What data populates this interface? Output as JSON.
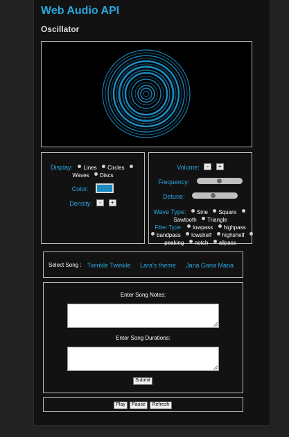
{
  "header": {
    "title": "Web Audio API",
    "subtitle": "Oscillator"
  },
  "display": {
    "label": "Display:",
    "options": [
      "Lines",
      "Circles",
      "Waves",
      "Discs"
    ],
    "color_label": "Color:",
    "color_value": "#1b8bc2",
    "density_label": "Density:",
    "minus": "-",
    "plus": "+"
  },
  "sound": {
    "volume_label": "Volume:",
    "frequency_label": "Frequency:",
    "frequency_level": 0.5,
    "detune_label": "Detune:",
    "detune_level": 0.45,
    "wave_label": "Wave Type:",
    "wave_options": [
      "Sine",
      "Square",
      "Sawtooth",
      "Triangle"
    ],
    "filter_label": "Filter Type:",
    "filter_options": [
      "lowpass",
      "highpass",
      "bandpass",
      "lowshelf",
      "highshelf",
      "peaking",
      "notch",
      "allpass"
    ]
  },
  "songs": {
    "label": "Select Song :",
    "items": [
      "Twinkle Twinkle",
      "Lara's theme",
      "Jana Gana Mana"
    ]
  },
  "notes": {
    "notes_label": "Enter Song Notes:",
    "notes_value": "",
    "durations_label": "Enter Song Durations:",
    "durations_value": "",
    "submit_label": "Submit"
  },
  "controls": {
    "play": "Play",
    "pause": "Pause",
    "refresh": "Refresh"
  },
  "colors": {
    "accent": "#2aa7dc",
    "background": "#121212",
    "visual": "#1b8bc2"
  }
}
